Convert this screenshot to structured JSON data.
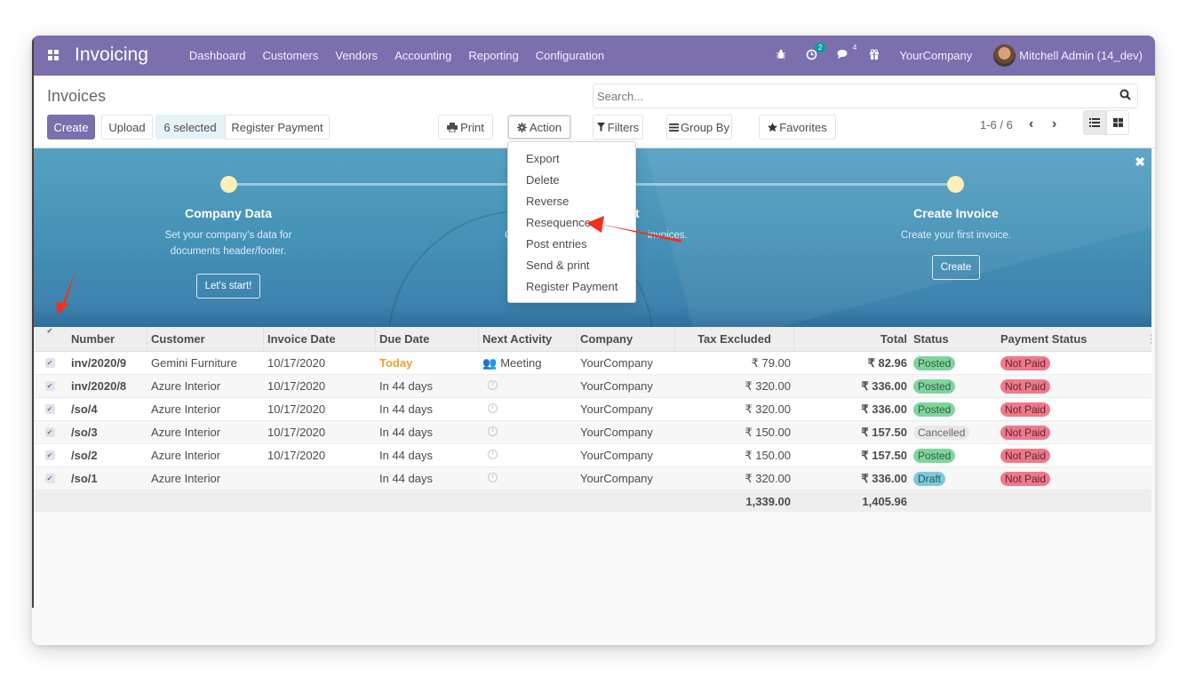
{
  "navbar": {
    "brand": "Invoicing",
    "menu": [
      "Dashboard",
      "Customers",
      "Vendors",
      "Accounting",
      "Reporting",
      "Configuration"
    ],
    "activity_badge": "2",
    "messages_count": "4",
    "company": "YourCompany",
    "user": "Mitchell Admin (14_dev)"
  },
  "control_panel": {
    "title": "Invoices",
    "create_label": "Create",
    "upload_label": "Upload",
    "selected_label": "6 selected",
    "register_payment_label": "Register Payment",
    "print_label": "Print",
    "action_label": "Action",
    "search_placeholder": "Search...",
    "filters_label": "Filters",
    "group_by_label": "Group By",
    "favorites_label": "Favorites",
    "pager": "1-6 / 6"
  },
  "action_menu": {
    "items": [
      "Export",
      "Delete",
      "Reverse",
      "Resequence",
      "Post entries",
      "Send & print",
      "Register Payment"
    ]
  },
  "onboarding": {
    "steps": [
      {
        "title": "Company Data",
        "line1": "Set your company's data for",
        "line2": "documents header/footer.",
        "button": "Let's start!"
      },
      {
        "title": "t",
        "line1": "C",
        "line2": "invoices.",
        "button": ""
      },
      {
        "title": "Create Invoice",
        "line1": "Create your first invoice.",
        "line2": "",
        "button": "Create"
      }
    ]
  },
  "table": {
    "headers": [
      "Number",
      "Customer",
      "Invoice Date",
      "Due Date",
      "Next Activity",
      "Company",
      "Tax Excluded",
      "Total",
      "Status",
      "Payment Status"
    ],
    "rows": [
      {
        "number": "inv/2020/9",
        "customer": "Gemini Furniture",
        "invoice_date": "10/17/2020",
        "due_date": "Today",
        "activity": "Meeting",
        "company": "YourCompany",
        "tax_excluded": "₹ 79.00",
        "total": "₹ 82.96",
        "status": "Posted",
        "payment_status": "Not Paid"
      },
      {
        "number": "inv/2020/8",
        "customer": "Azure Interior",
        "invoice_date": "10/17/2020",
        "due_date": "In 44 days",
        "activity": "",
        "company": "YourCompany",
        "tax_excluded": "₹ 320.00",
        "total": "₹ 336.00",
        "status": "Posted",
        "payment_status": "Not Paid"
      },
      {
        "number": "/so/4",
        "customer": "Azure Interior",
        "invoice_date": "10/17/2020",
        "due_date": "In 44 days",
        "activity": "",
        "company": "YourCompany",
        "tax_excluded": "₹ 320.00",
        "total": "₹ 336.00",
        "status": "Posted",
        "payment_status": "Not Paid"
      },
      {
        "number": "/so/3",
        "customer": "Azure Interior",
        "invoice_date": "10/17/2020",
        "due_date": "In 44 days",
        "activity": "",
        "company": "YourCompany",
        "tax_excluded": "₹ 150.00",
        "total": "₹ 157.50",
        "status": "Cancelled",
        "payment_status": "Not Paid"
      },
      {
        "number": "/so/2",
        "customer": "Azure Interior",
        "invoice_date": "10/17/2020",
        "due_date": "In 44 days",
        "activity": "",
        "company": "YourCompany",
        "tax_excluded": "₹ 150.00",
        "total": "₹ 157.50",
        "status": "Posted",
        "payment_status": "Not Paid"
      },
      {
        "number": "/so/1",
        "customer": "Azure Interior",
        "invoice_date": "",
        "due_date": "In 44 days",
        "activity": "",
        "company": "YourCompany",
        "tax_excluded": "₹ 320.00",
        "total": "₹ 336.00",
        "status": "Draft",
        "payment_status": "Not Paid"
      }
    ],
    "totals": {
      "tax_excluded": "1,339.00",
      "total": "1,405.96"
    }
  },
  "colors": {
    "brand": "#7c6fae",
    "posted": "#7ed59c",
    "draft": "#79cbd9",
    "cancelled": "#e9e9e9",
    "not_paid": "#f0788a",
    "today": "#e4a72b",
    "annotation_arrow": "#f0321e"
  }
}
